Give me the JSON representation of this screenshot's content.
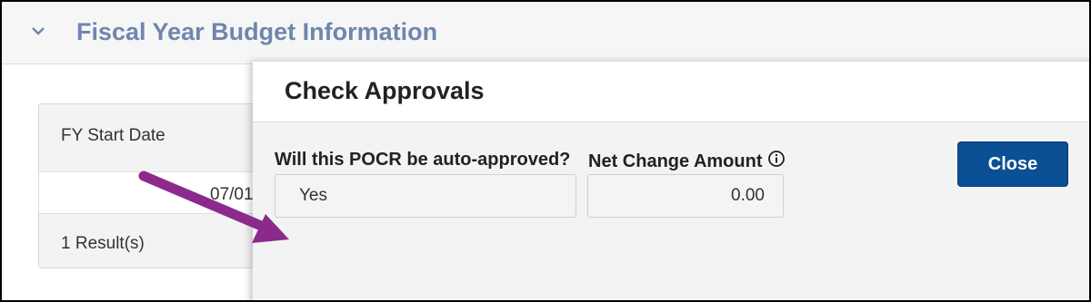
{
  "section": {
    "title": "Fiscal Year Budget Information"
  },
  "table": {
    "column_header": "FY Start Date",
    "cell_value": "07/01/20",
    "result_count": "1 Result(s)"
  },
  "modal": {
    "title": "Check Approvals",
    "close_label": "Close",
    "auto_approved_label": "Will this POCR be auto-approved?",
    "auto_approved_value": "Yes",
    "net_change_label": "Net Change Amount",
    "net_change_value": "0.00"
  },
  "icons": {
    "section_toggle": "chevron-down-icon",
    "net_change_info": "info-icon",
    "annotation": "arrow-icon"
  },
  "colors": {
    "section_title": "#6f86ad",
    "close_button": "#0b4f94",
    "annotation_arrow": "#8b2a8c"
  }
}
